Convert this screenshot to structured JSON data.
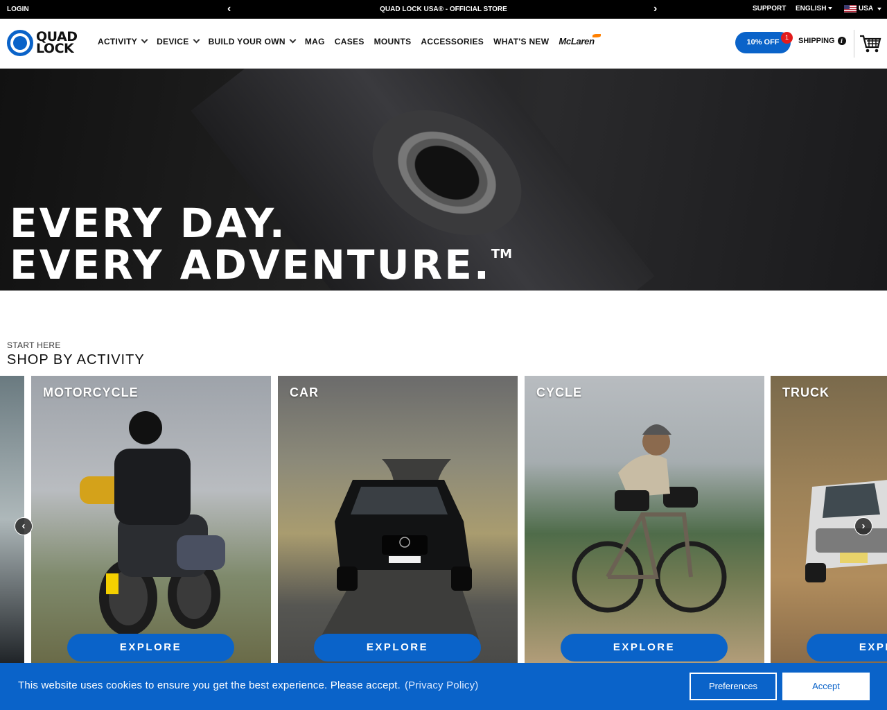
{
  "topbar": {
    "login": "LOGIN",
    "promo": "QUAD LOCK USA® - OFFICIAL STORE",
    "support": "SUPPORT",
    "language": "ENGLISH",
    "country": "USA"
  },
  "header": {
    "logo_line1": "QUAD",
    "logo_line2": "LOCK",
    "nav": {
      "activity": "ACTIVITY",
      "device": "DEVICE",
      "build": "BUILD YOUR OWN",
      "mag": "MAG",
      "cases": "CASES",
      "mounts": "MOUNTS",
      "accessories": "ACCESSORIES",
      "whats_new": "WHAT'S NEW",
      "mclaren": "McLaren"
    },
    "discount": "10% OFF",
    "discount_badge": "1",
    "shipping": "SHIPPING",
    "info_glyph": "i"
  },
  "hero": {
    "line1": "EVERY DAY.",
    "line2": "EVERY ADVENTURE.",
    "tm": "TM"
  },
  "activity": {
    "kicker": "START HERE",
    "title": "SHOP BY ACTIVITY",
    "cards": [
      {
        "label": "MOTORCYCLE",
        "cta": "EXPLORE"
      },
      {
        "label": "CAR",
        "cta": "EXPLORE"
      },
      {
        "label": "CYCLE",
        "cta": "EXPLORE"
      },
      {
        "label": "TRUCK",
        "cta": "EXPLORE"
      }
    ],
    "prev_glyph": "‹",
    "next_glyph": "›"
  },
  "cookie": {
    "message": "This website uses cookies to ensure you get the best experience. Please accept.",
    "policy": "(Privacy Policy)",
    "preferences": "Preferences",
    "accept": "Accept"
  },
  "colors": {
    "brand_blue": "#0a63c9",
    "badge_red": "#e21b1b",
    "mclaren_orange": "#ff8000"
  },
  "icons": [
    "chevron-left-icon",
    "chevron-right-icon",
    "us-flag-icon",
    "caret-down-icon",
    "chevron-down-icon",
    "info-icon",
    "cart-icon"
  ]
}
